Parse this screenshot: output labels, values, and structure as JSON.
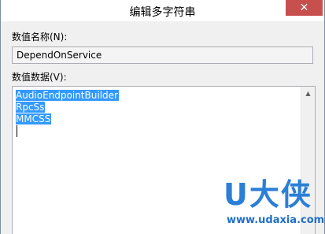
{
  "window": {
    "title": "编辑多字符串",
    "close_glyph": "✕"
  },
  "form": {
    "name_label": "数值名称(N):",
    "name_value": "DependOnService",
    "data_label": "数值数据(V):",
    "data_lines": [
      "AudioEndpointBuilder",
      "RpcSs",
      "MMCSS"
    ]
  },
  "scrollbar": {
    "up_glyph": "▲"
  },
  "watermark": {
    "logo": "U大侠",
    "url": "www.udaxia.com"
  },
  "colors": {
    "selection": "#3399ff",
    "close_button": "#c7504f",
    "watermark": "#2b7fd6"
  }
}
